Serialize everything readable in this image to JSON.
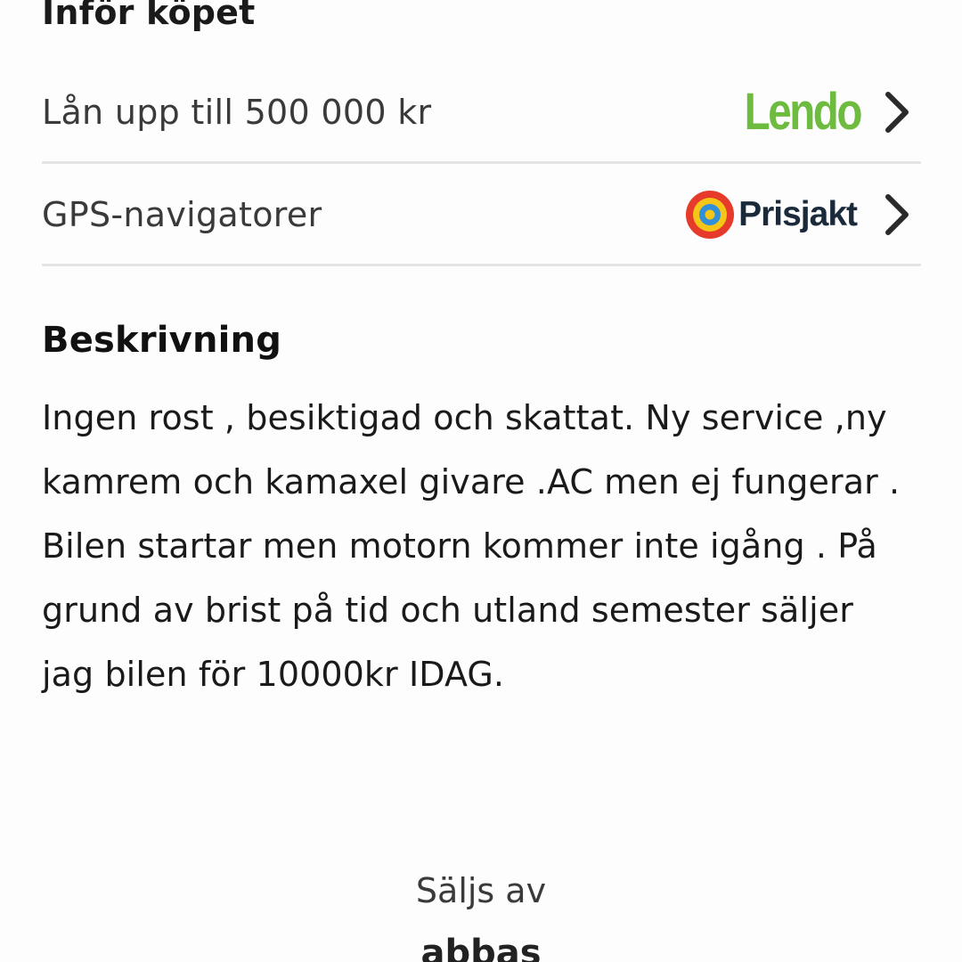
{
  "before_purchase": {
    "title": "Inför köpet",
    "items": [
      {
        "label": "Lån upp till 500 000 kr",
        "partner_logo": "Lendo"
      },
      {
        "label": "GPS-navigatorer",
        "partner_logo": "Prisjakt"
      }
    ]
  },
  "description": {
    "title": "Beskrivning",
    "lines": [
      "Ingen rost , besiktigad och skattat. Ny service ,ny",
      "kamrem och kamaxel givare .AC men ej fungerar .",
      "Bilen startar men motorn kommer inte igång . På",
      "grund av brist på tid och utland semester säljer",
      "jag bilen för 10000kr IDAG."
    ]
  },
  "seller": {
    "label": "Säljs av",
    "name": "abbas"
  },
  "colors": {
    "lendo_green": "#6dbb3f",
    "prisjakt_navy": "#1a2a3a",
    "divider": "#e4e4e4"
  },
  "icons": {
    "row_chevron": "chevron-right-icon",
    "prisjakt_emblem": "target-icon"
  }
}
